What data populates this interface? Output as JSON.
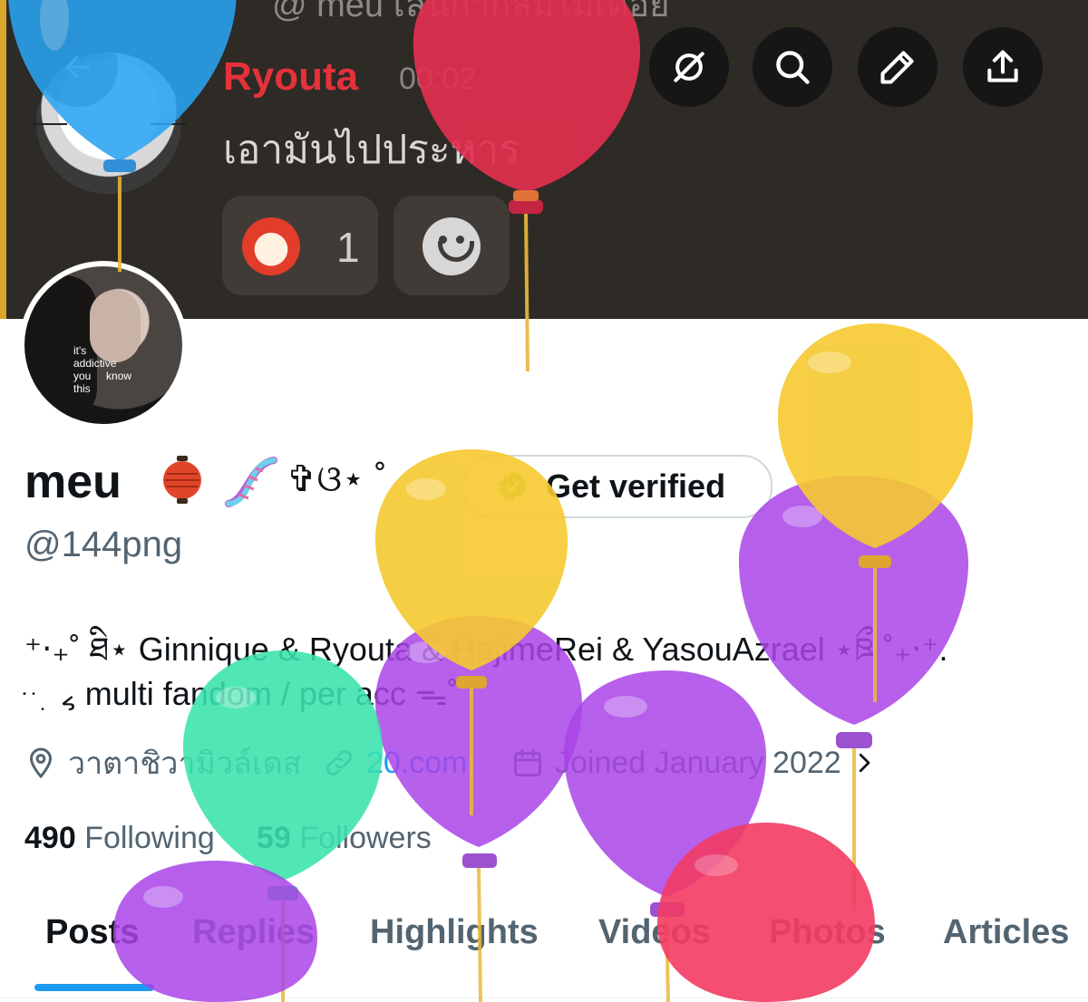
{
  "banner": {
    "chat_top_text": "@ meu   เล่นกาก็ล้มไม่เดือย",
    "chat_author": "Ryouta",
    "chat_time": "00:02",
    "chat_message": "เอามันไปประหาร",
    "reaction_count": "1",
    "reaction_emoji_label": "555"
  },
  "toolbar": {
    "icons": [
      "back-arrow-icon",
      "hide-icon",
      "search-icon",
      "edit-icon",
      "share-icon"
    ]
  },
  "profile": {
    "display_name": "meu",
    "name_decoration": "✞ଓ⋆ ˚",
    "verify_label": "Get verified",
    "handle": "@144png",
    "bio_line1": "⁺‧₊˚ ཐི⋆ Ginnique & Ryouta & HajimeRei & YasouAzrael ⋆ཋྀ ˚₊‧⁺.",
    "bio_line2": "ּ ּ ּ ִ ៹ multi fandom / per acc ᯓ˚",
    "location": "วาตาชิวามิวล์เดส",
    "website": "20.com",
    "joined": "Joined January 2022"
  },
  "stats": {
    "following_count": "490",
    "following_label": "Following",
    "followers_count": "59",
    "followers_label": "Followers"
  },
  "tabs": [
    "Posts",
    "Replies",
    "Highlights",
    "Videos",
    "Photos",
    "Articles"
  ],
  "colors": {
    "accent": "#1d9bf0",
    "text_primary": "#0f1419",
    "text_secondary": "#536471",
    "chat_author": "#e5313a",
    "balloon_blue": "#2aa3f2",
    "balloon_red": "#e2304f",
    "balloon_yellow": "#f6c930",
    "balloon_purple": "#a944e8",
    "balloon_green": "#3ae3ad",
    "balloon_pink": "#f33b64"
  }
}
